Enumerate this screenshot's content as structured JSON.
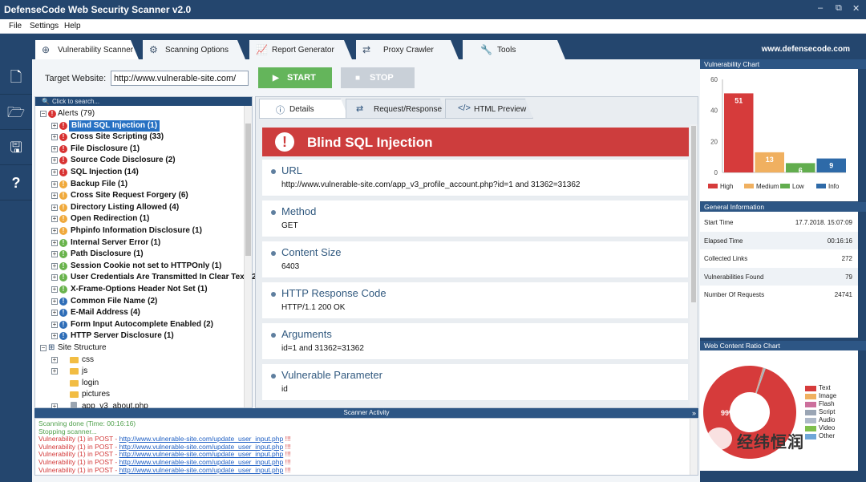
{
  "window": {
    "title": "DefenseCode Web Security Scanner v2.0",
    "controls": [
      "–",
      "⧉",
      "✕"
    ]
  },
  "menu": [
    "File",
    "Settings",
    "Help"
  ],
  "main_tabs": [
    {
      "label": "Vulnerability Scanner",
      "icon": "target-icon"
    },
    {
      "label": "Scanning Options",
      "icon": "gears-icon"
    },
    {
      "label": "Report Generator",
      "icon": "chart-line-icon"
    },
    {
      "label": "Proxy Crawler",
      "icon": "arrows-icon"
    },
    {
      "label": "Tools",
      "icon": "wrench-icon"
    }
  ],
  "site": "www.defensecode.com",
  "left_icons": [
    "new-file-icon",
    "open-folder-icon",
    "save-icon",
    "help-icon"
  ],
  "target": {
    "label": "Target Website:",
    "value": "http://www.vulnerable-site.com/"
  },
  "buttons": {
    "start": "START",
    "stop": "STOP"
  },
  "search": {
    "placeholder": "Click to search..."
  },
  "tree": {
    "alerts_root": "Alerts (79)",
    "alerts": [
      {
        "label": "Blind SQL Injection (1)",
        "sev": "red",
        "selected": true
      },
      {
        "label": "Cross Site Scripting (33)",
        "sev": "red"
      },
      {
        "label": "File Disclosure (1)",
        "sev": "red"
      },
      {
        "label": "Source Code Disclosure (2)",
        "sev": "red"
      },
      {
        "label": "SQL Injection (14)",
        "sev": "red"
      },
      {
        "label": "Backup File (1)",
        "sev": "ora"
      },
      {
        "label": "Cross Site Request Forgery (6)",
        "sev": "ora"
      },
      {
        "label": "Directory Listing Allowed (4)",
        "sev": "ora"
      },
      {
        "label": "Open Redirection (1)",
        "sev": "ora"
      },
      {
        "label": "Phpinfo Information Disclosure (1)",
        "sev": "ora"
      },
      {
        "label": "Internal Server Error (1)",
        "sev": "grn"
      },
      {
        "label": "Path Disclosure (1)",
        "sev": "grn"
      },
      {
        "label": "Session Cookie not set to HTTPOnly (1)",
        "sev": "grn"
      },
      {
        "label": "User Credentials Are Transmitted In Clear Text (2)",
        "sev": "grn"
      },
      {
        "label": "X-Frame-Options Header Not Set (1)",
        "sev": "grn"
      },
      {
        "label": "Common File Name (2)",
        "sev": "blu"
      },
      {
        "label": "E-Mail Address (4)",
        "sev": "blu"
      },
      {
        "label": "Form Input Autocomplete Enabled (2)",
        "sev": "blu"
      },
      {
        "label": "HTTP Server Disclosure (1)",
        "sev": "blu"
      }
    ],
    "structure_root": "Site Structure",
    "structure": [
      {
        "label": "css",
        "type": "folder"
      },
      {
        "label": "js",
        "type": "folder"
      },
      {
        "label": "login",
        "type": "folder"
      },
      {
        "label": "pictures",
        "type": "folder"
      },
      {
        "label": "app_v3_about.php",
        "type": "file"
      }
    ]
  },
  "detail_tabs": [
    {
      "label": "Details",
      "icon": "info-icon"
    },
    {
      "label": "Request/Response",
      "icon": "swap-icon"
    },
    {
      "label": "HTML Preview",
      "icon": "code-icon"
    }
  ],
  "detail": {
    "title": "Blind SQL Injection",
    "sections": [
      {
        "title": "URL",
        "value": "http://www.vulnerable-site.com/app_v3_profile_account.php?id=1 and 31362=31362"
      },
      {
        "title": "Method",
        "value": "GET"
      },
      {
        "title": "Content Size",
        "value": "6403"
      },
      {
        "title": "HTTP Response Code",
        "value": "HTTP/1.1 200 OK"
      },
      {
        "title": "Arguments",
        "value": "id=1 and 31362=31362"
      },
      {
        "title": "Vulnerable Parameter",
        "value": "id"
      }
    ]
  },
  "activity": {
    "title": "Scanner Activity",
    "lines": [
      {
        "text": "Scanning done (Time: 00:16:16)",
        "color": "green"
      },
      {
        "text": "Stopping scanner...",
        "color": "green"
      },
      {
        "prefix": "Vulnerability (1) in POST - ",
        "url": "http://www.vulnerable-site.com/update_user_input.php",
        "suffix": " !!!",
        "color": "red"
      },
      {
        "prefix": "Vulnerability (1) in POST - ",
        "url": "http://www.vulnerable-site.com/update_user_input.php",
        "suffix": " !!!",
        "color": "red"
      },
      {
        "prefix": "Vulnerability (1) in POST - ",
        "url": "http://www.vulnerable-site.com/update_user_input.php",
        "suffix": " !!!",
        "color": "red"
      },
      {
        "prefix": "Vulnerability (1) in POST - ",
        "url": "http://www.vulnerable-site.com/update_user_input.php",
        "suffix": " !!!",
        "color": "red"
      },
      {
        "prefix": "Vulnerability (1) in POST - ",
        "url": "http://www.vulnerable-site.com/update_user_input.php",
        "suffix": " !!!",
        "color": "red"
      }
    ]
  },
  "vuln_chart_title": "Vulnerability Chart",
  "general": {
    "title": "General Information",
    "rows": [
      {
        "k": "Start Time",
        "v": "17.7.2018. 15:07:09"
      },
      {
        "k": "Elapsed Time",
        "v": "00:16:16"
      },
      {
        "k": "Collected Links",
        "v": "272"
      },
      {
        "k": "Vulnerabilities Found",
        "v": "79"
      },
      {
        "k": "Number Of Requests",
        "v": "24741"
      }
    ]
  },
  "ratio_title": "Web Content Ratio Chart",
  "watermark": "经纬恒润",
  "chart_data": [
    {
      "type": "bar",
      "categories": [
        "High",
        "Medium",
        "Low",
        "Info"
      ],
      "values": [
        51,
        13,
        6,
        9
      ],
      "colors": [
        "#d63b3b",
        "#f0b060",
        "#62ad4e",
        "#2e6aa8"
      ],
      "ylim": [
        0,
        60
      ],
      "yticks": [
        0,
        20,
        40,
        60
      ],
      "legend": "bottom"
    },
    {
      "type": "pie",
      "labels": [
        "Text",
        "Image",
        "Flash",
        "Script",
        "Audio",
        "Video",
        "Other"
      ],
      "values": [
        99,
        0.2,
        0.2,
        0.2,
        0.2,
        0.1,
        0.1
      ],
      "value_label": "99%",
      "colors": [
        "#d63b3b",
        "#f0b060",
        "#cc6f9c",
        "#9aa5b4",
        "#aeb9c9",
        "#7fbf4d",
        "#6fa6d8"
      ],
      "legend": "right"
    }
  ]
}
